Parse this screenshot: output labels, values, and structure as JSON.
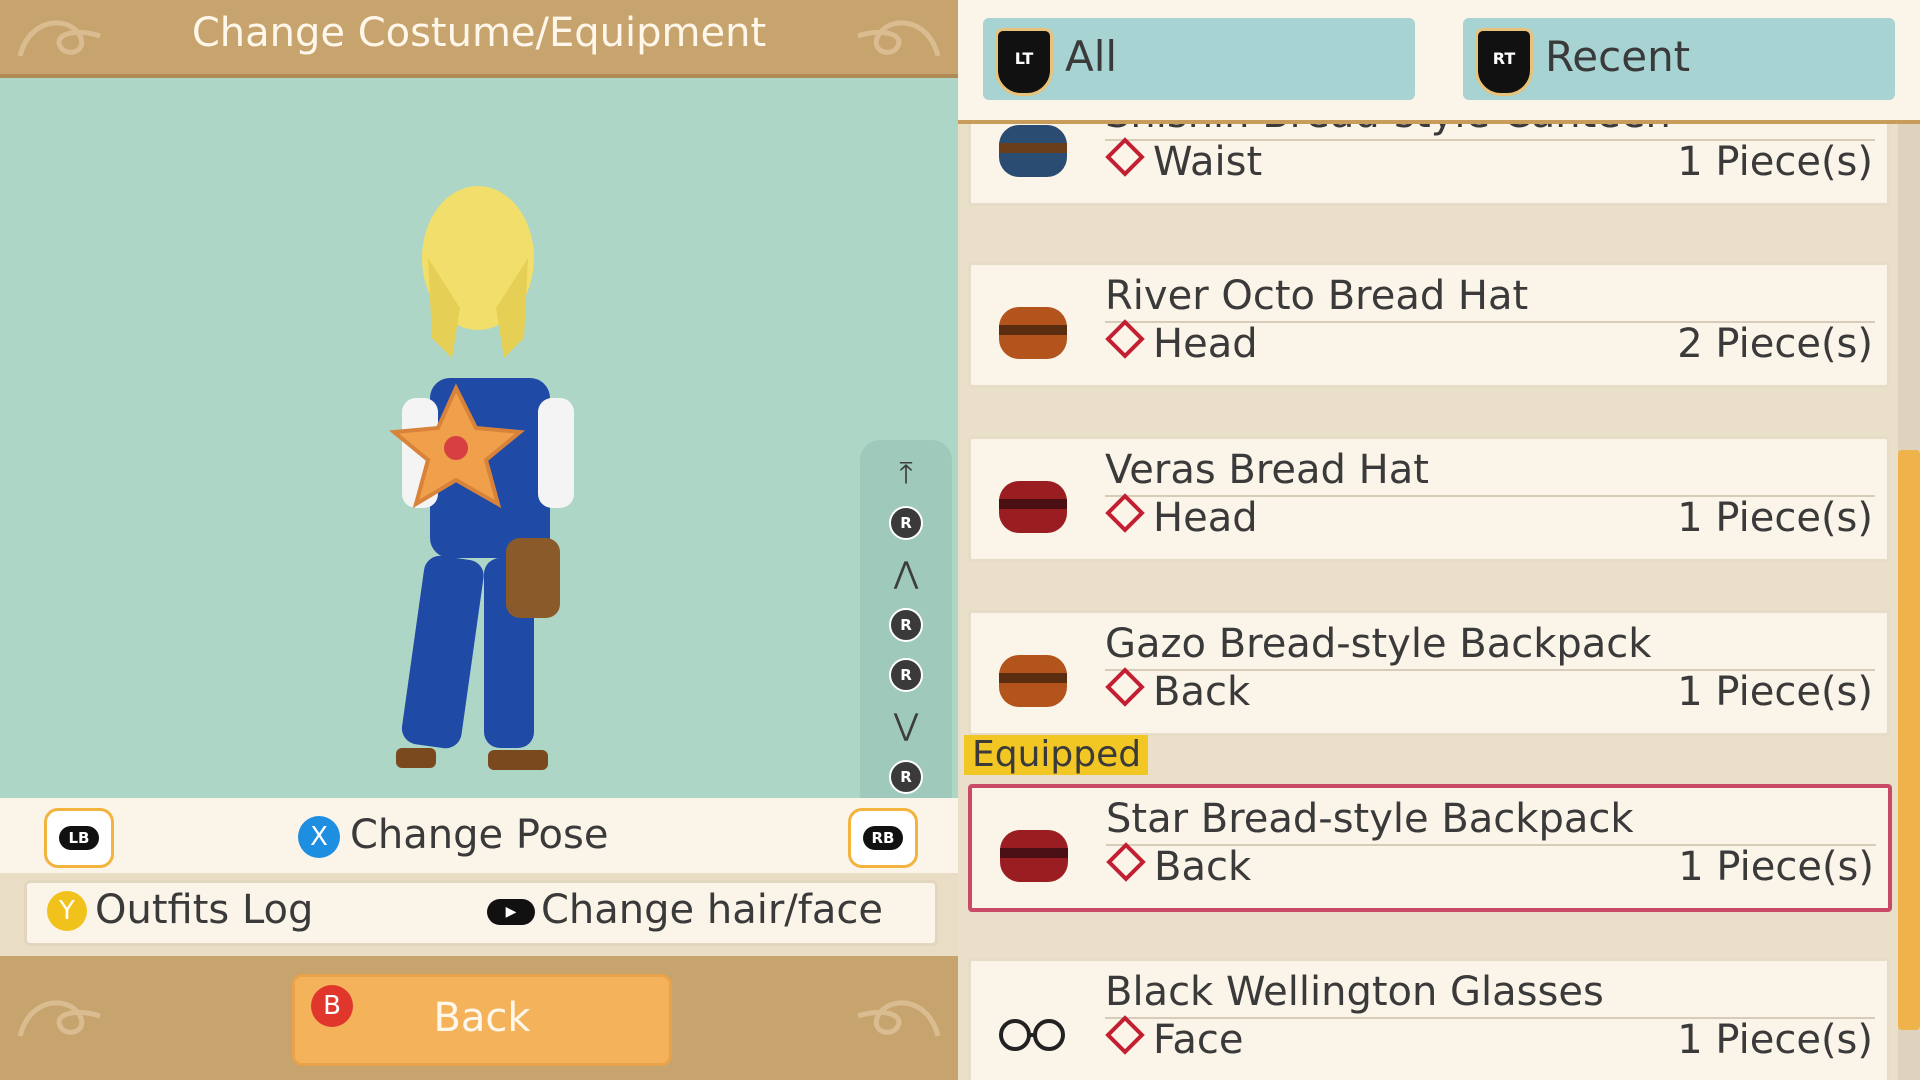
{
  "header": {
    "title": "Change Costume/Equipment"
  },
  "view_controls": {
    "items": [
      "⤒",
      "R",
      "⋀",
      "R",
      "R",
      "⋁",
      "R",
      "⤓"
    ]
  },
  "pose_bar": {
    "lb": "LB",
    "x_button": "X",
    "change_pose": "Change Pose",
    "rb": "RB"
  },
  "options_bar": {
    "y_button": "Y",
    "outfits_log": "Outfits Log",
    "stick": "▶",
    "change_hair_face": "Change hair/face"
  },
  "footer": {
    "b_button": "B",
    "back": "Back"
  },
  "tabs": [
    {
      "shoulder": "LT",
      "label": "All"
    },
    {
      "shoulder": "RT",
      "label": "Recent"
    }
  ],
  "items": [
    {
      "name": "Shishin Bread-style Canteen",
      "slot": "Waist",
      "count": "1 Piece(s)",
      "icon_color": "#2a4b72",
      "icon": "canteen-icon"
    },
    {
      "name": "River Octo Bread Hat",
      "slot": "Head",
      "count": "2 Piece(s)",
      "icon_color": "#b2541c",
      "icon": "bread-hat-icon"
    },
    {
      "name": "Veras Bread Hat",
      "slot": "Head",
      "count": "1 Piece(s)",
      "icon_color": "#9a1d22",
      "icon": "bread-hat-icon"
    },
    {
      "name": "Gazo Bread-style Backpack",
      "slot": "Back",
      "count": "1 Piece(s)",
      "icon_color": "#b2541c",
      "icon": "backpack-icon"
    },
    {
      "name": "Star Bread-style Backpack",
      "slot": "Back",
      "count": "1 Piece(s)",
      "icon_color": "#9a1d22",
      "icon": "backpack-icon",
      "equipped": true
    },
    {
      "name": "Black Wellington Glasses",
      "slot": "Face",
      "count": "1 Piece(s)",
      "icon_color": "#222222",
      "icon": "glasses-icon"
    }
  ],
  "equipped_label": "Equipped"
}
